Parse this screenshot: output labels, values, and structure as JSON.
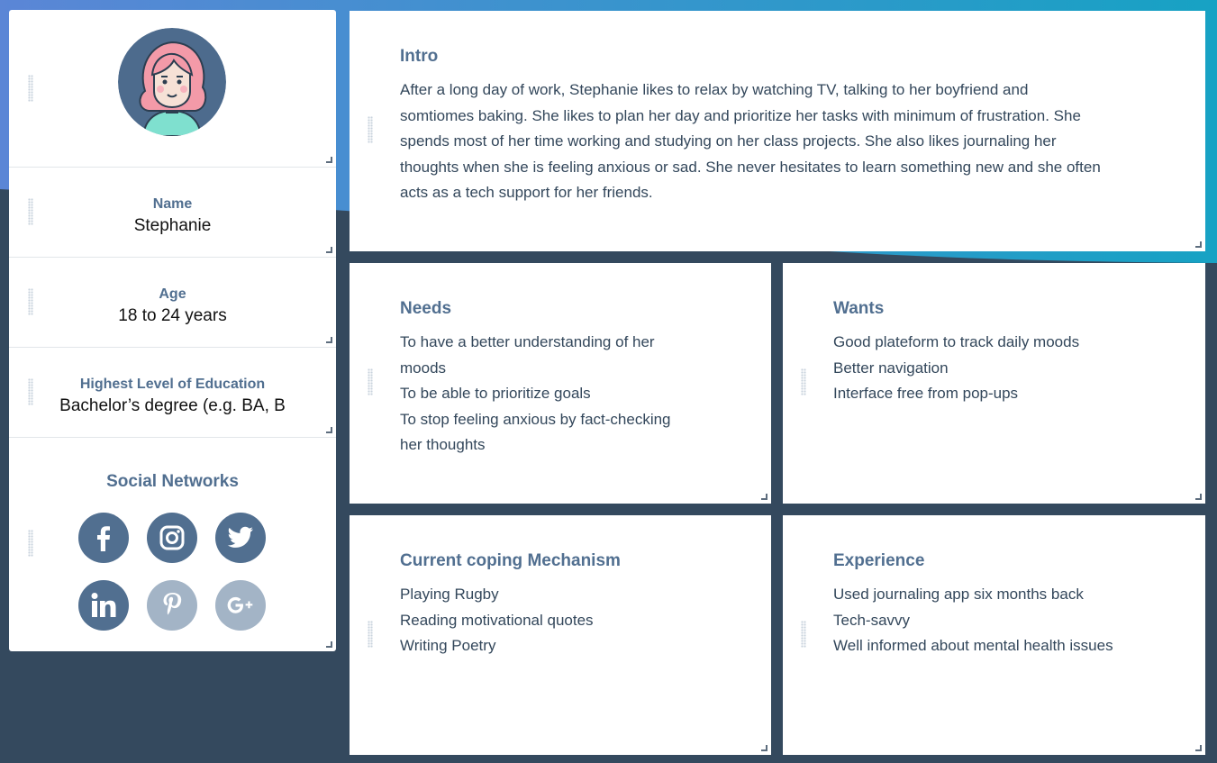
{
  "colors": {
    "page_background": "#34495e",
    "gradient_start": "#5b86d6",
    "gradient_end": "#17a2c4",
    "accent": "#516f90",
    "icon_disabled": "#a3b4c6"
  },
  "profile": {
    "avatar_icon": "woman-avatar-icon",
    "name_label": "Name",
    "name_value": "Stephanie",
    "age_label": "Age",
    "age_value": "18 to 24 years",
    "education_label": "Highest Level of Education",
    "education_value": "Bachelor’s degree (e.g. BA, B"
  },
  "social": {
    "title": "Social Networks",
    "networks": [
      {
        "name": "facebook",
        "icon": "facebook-icon",
        "active": true
      },
      {
        "name": "instagram",
        "icon": "instagram-icon",
        "active": true
      },
      {
        "name": "twitter",
        "icon": "twitter-icon",
        "active": true
      },
      {
        "name": "linkedin",
        "icon": "linkedin-icon",
        "active": true
      },
      {
        "name": "pinterest",
        "icon": "pinterest-icon",
        "active": false
      },
      {
        "name": "google-plus",
        "icon": "google-plus-icon",
        "active": false
      }
    ]
  },
  "intro": {
    "title": "Intro",
    "lines": [
      "After a long day of work, Stephanie likes to relax by watching TV, talking to her boyfriend and",
      "somtiomes baking. She likes to plan her day and prioritize her tasks with minimum of frustration. She",
      "spends most of her time working and studying on her class projects. She also likes journaling her",
      "thoughts when she is feeling anxious or sad. She never hesitates to learn something new and she often",
      "acts as a tech support for her friends."
    ]
  },
  "needs": {
    "title": "Needs",
    "lines": [
      "To have a better understanding of her",
      "moods",
      "To be able to prioritize goals",
      "To stop feeling anxious by  fact-checking",
      "her thoughts"
    ]
  },
  "wants": {
    "title": "Wants",
    "lines": [
      "Good plateform to track daily moods",
      "Better navigation",
      "Interface free from pop-ups"
    ]
  },
  "coping": {
    "title": "Current coping Mechanism",
    "lines": [
      "Playing Rugby",
      "Reading motivational quotes",
      "Writing Poetry"
    ]
  },
  "experience": {
    "title": "Experience",
    "lines": [
      "Used journaling app six months back",
      "Tech-savvy",
      "Well informed about mental health issues"
    ]
  }
}
